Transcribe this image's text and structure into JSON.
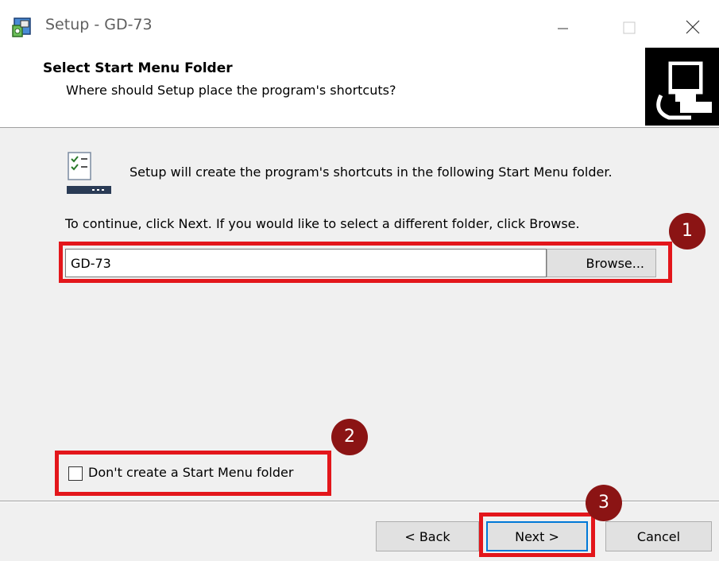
{
  "window": {
    "title": "Setup - GD-73",
    "icon": "installer-icon",
    "controls": [
      "minimize-icon",
      "maximize-icon",
      "close-icon"
    ]
  },
  "header": {
    "title": "Select Start Menu Folder",
    "subtitle": "Where should Setup place the program's shortcuts?",
    "image": "computer-icon"
  },
  "content": {
    "icon": "start-menu-icon",
    "info_text": "Setup will create the program's shortcuts in the following Start Menu folder.",
    "continue_text": "To continue, click Next. If you would like to select a different folder, click Browse.",
    "folder_value": "GD-73",
    "browse_label": "Browse...",
    "no_folder_checkbox_label": "Don't create a Start Menu folder",
    "no_folder_checked": false
  },
  "annotations": {
    "badge1": "1",
    "badge2": "2",
    "badge3": "3",
    "highlight_color": "#e3161b",
    "badge_color": "#8b1414"
  },
  "buttons": {
    "back": "< Back",
    "next": "Next >",
    "cancel": "Cancel"
  }
}
